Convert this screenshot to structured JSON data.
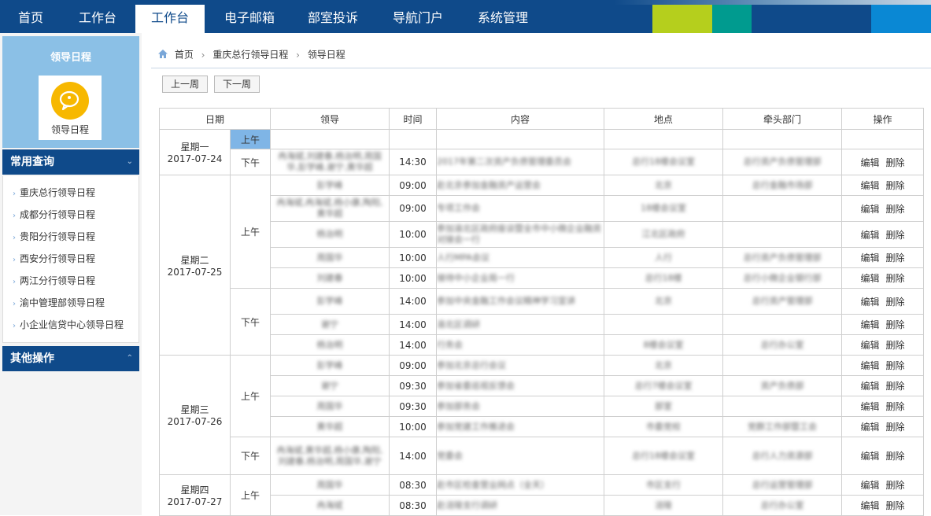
{
  "nav": {
    "tabs": [
      {
        "label": "首页",
        "active": false
      },
      {
        "label": "工作台",
        "active": false
      },
      {
        "label": "工作台",
        "active": true
      },
      {
        "label": "电子邮箱",
        "active": false
      },
      {
        "label": "部室投诉",
        "active": false
      },
      {
        "label": "导航门户",
        "active": false
      },
      {
        "label": "系统管理",
        "active": false
      }
    ],
    "color_blocks": [
      "#b5cf1d",
      "#009b8f",
      "#0f4a8a",
      "#0a88d4"
    ]
  },
  "sidebar": {
    "hero_title": "领导日程",
    "hero_icon": "chat-bubble-icon",
    "hero_label": "领导日程",
    "common_title": "常用查询",
    "items": [
      "重庆总行领导日程",
      "成都分行领导日程",
      "贵阳分行领导日程",
      "西安分行领导日程",
      "两江分行领导日程",
      "渝中管理部领导日程",
      "小企业信贷中心领导日程"
    ],
    "other_title": "其他操作"
  },
  "breadcrumb": {
    "home_icon": "home-icon",
    "items": [
      "首页",
      "重庆总行领导日程",
      "领导日程"
    ]
  },
  "toolbar": {
    "prev_week": "上一周",
    "next_week": "下一周"
  },
  "table": {
    "headers": [
      "日期",
      "领导",
      "时间",
      "内容",
      "地点",
      "牵头部门",
      "操作"
    ],
    "edit_label": "编辑",
    "delete_label": "删除",
    "days": [
      {
        "weekday": "星期一",
        "date": "2017-07-24",
        "periods": [
          {
            "label": "上午",
            "selected": true,
            "rows": [
              {
                "leader": "",
                "time": "",
                "content": "",
                "place": "",
                "dept": "",
                "ops": false
              }
            ]
          },
          {
            "label": "下午",
            "rows": [
              {
                "leader": "冉海斌,刘建春,杨治明,周国华,彭学峰,谢宁,黄华超",
                "time": "14:30",
                "content": "2017年第二次资产负债管理委员会",
                "place": "总行18楼会议室",
                "dept": "总行资产负债管理部",
                "ops": true
              }
            ]
          }
        ]
      },
      {
        "weekday": "星期二",
        "date": "2017-07-25",
        "periods": [
          {
            "label": "上午",
            "rows": [
              {
                "leader": "彭学峰",
                "time": "09:00",
                "content": "赴北京参加金融资产运营会",
                "place": "北京",
                "dept": "总行金融市场部",
                "ops": true
              },
              {
                "leader": "冉海斌,冉海斌,杨小康,陶阳,黄华超",
                "time": "09:00",
                "content": "专项工作会",
                "place": "18楼会议室",
                "dept": "",
                "ops": true
              },
              {
                "leader": "杨治明",
                "time": "10:00",
                "content": "参加渝北区政府座谈暨全市中小微企业融资对接会一行",
                "place": "江北区政府",
                "dept": "",
                "ops": true
              },
              {
                "leader": "周国华",
                "time": "10:00",
                "content": "人行MPA会议",
                "place": "人行",
                "dept": "总行资产负债管理部",
                "ops": true
              },
              {
                "leader": "刘建春",
                "time": "10:00",
                "content": "接待中小企业局一行",
                "place": "总行18楼",
                "dept": "总行小微企业银行部",
                "ops": true
              }
            ]
          },
          {
            "label": "下午",
            "rows": [
              {
                "leader": "彭学峰",
                "time": "14:00",
                "content": "参加中央金融工作会议精神学习宣讲",
                "place": "北京",
                "dept": "总行资产管理部",
                "ops": true
              },
              {
                "leader": "谢宁",
                "time": "14:00",
                "content": "渝北区调研",
                "place": "",
                "dept": "",
                "ops": true
              },
              {
                "leader": "杨治明",
                "time": "14:00",
                "content": "行务会",
                "place": "8楼会议室",
                "dept": "总行办公室",
                "ops": true
              }
            ]
          }
        ]
      },
      {
        "weekday": "星期三",
        "date": "2017-07-26",
        "periods": [
          {
            "label": "上午",
            "rows": [
              {
                "leader": "彭学峰",
                "time": "09:00",
                "content": "参加北京总行会议",
                "place": "北京",
                "dept": "",
                "ops": true
              },
              {
                "leader": "谢宁",
                "time": "09:30",
                "content": "参加省委巡视反馈会",
                "place": "总行7楼会议室",
                "dept": "资产负债部",
                "ops": true
              },
              {
                "leader": "周国华",
                "time": "09:30",
                "content": "参加部务会",
                "place": "部室",
                "dept": "",
                "ops": true
              },
              {
                "leader": "黄华超",
                "time": "10:00",
                "content": "参加党建工作推进会",
                "place": "市委党校",
                "dept": "党群工作部暨工会",
                "ops": true
              }
            ]
          },
          {
            "label": "下午",
            "rows": [
              {
                "leader": "冉海斌,黄华超,杨小康,陶阳,刘建春,杨治明,周国华,谢宁",
                "time": "14:00",
                "content": "党委会",
                "place": "总行18楼会议室",
                "dept": "总行人力资源部",
                "ops": true
              }
            ]
          }
        ]
      },
      {
        "weekday": "星期四",
        "date": "2017-07-27",
        "periods": [
          {
            "label": "上午",
            "rows": [
              {
                "leader": "周国华",
                "time": "08:30",
                "content": "赴市区检查营业网点（全天）",
                "place": "市区支行",
                "dept": "总行运营管理部",
                "ops": true
              },
              {
                "leader": "冉海斌",
                "time": "08:30",
                "content": "赴涪陵支行调研",
                "place": "涪陵",
                "dept": "总行办公室",
                "ops": true
              }
            ]
          }
        ]
      }
    ]
  }
}
